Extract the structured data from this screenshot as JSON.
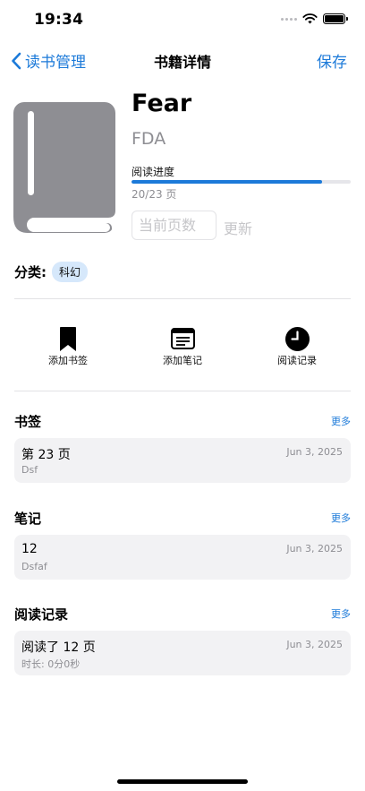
{
  "status_bar": {
    "time": "19:34"
  },
  "nav": {
    "back_label": "读书管理",
    "title": "书籍详情",
    "save_label": "保存"
  },
  "book": {
    "title": "Fear",
    "author": "FDA",
    "progress_label": "阅读进度",
    "progress_text": "20/23 页",
    "progress_fraction": 0.87,
    "page_placeholder": "当前页数",
    "update_label": "更新",
    "cover_icon": "book-icon",
    "cover_color": "#8e8e93"
  },
  "category": {
    "label": "分类:",
    "tag": "科幻"
  },
  "actions": [
    {
      "label": "添加书签",
      "icon": "bookmark-icon"
    },
    {
      "label": "添加笔记",
      "icon": "note-icon"
    },
    {
      "label": "阅读记录",
      "icon": "clock-icon"
    }
  ],
  "sections": {
    "bookmarks": {
      "title": "书签",
      "more": "更多",
      "items": [
        {
          "title": "第 23 页",
          "subtitle": "Dsf",
          "date": "Jun 3, 2025"
        }
      ]
    },
    "notes": {
      "title": "笔记",
      "more": "更多",
      "items": [
        {
          "title": "12",
          "subtitle": "Dsfaf",
          "date": "Jun 3, 2025"
        }
      ]
    },
    "records": {
      "title": "阅读记录",
      "more": "更多",
      "items": [
        {
          "title": "阅读了 12 页",
          "subtitle": "时长: 0分0秒",
          "date": "Jun 3, 2025"
        }
      ]
    }
  },
  "colors": {
    "accent": "#1c7ad9",
    "tag_bg": "#d6e8fb",
    "card_bg": "#f2f2f4"
  }
}
